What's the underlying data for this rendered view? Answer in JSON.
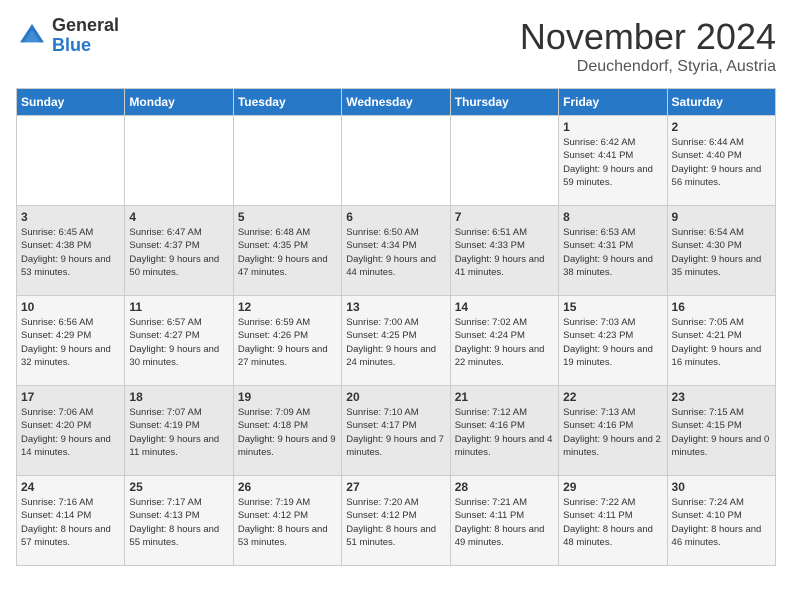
{
  "header": {
    "logo_general": "General",
    "logo_blue": "Blue",
    "month_title": "November 2024",
    "location": "Deuchendorf, Styria, Austria"
  },
  "weekdays": [
    "Sunday",
    "Monday",
    "Tuesday",
    "Wednesday",
    "Thursday",
    "Friday",
    "Saturday"
  ],
  "weeks": [
    [
      {
        "day": "",
        "info": ""
      },
      {
        "day": "",
        "info": ""
      },
      {
        "day": "",
        "info": ""
      },
      {
        "day": "",
        "info": ""
      },
      {
        "day": "",
        "info": ""
      },
      {
        "day": "1",
        "info": "Sunrise: 6:42 AM\nSunset: 4:41 PM\nDaylight: 9 hours and 59 minutes."
      },
      {
        "day": "2",
        "info": "Sunrise: 6:44 AM\nSunset: 4:40 PM\nDaylight: 9 hours and 56 minutes."
      }
    ],
    [
      {
        "day": "3",
        "info": "Sunrise: 6:45 AM\nSunset: 4:38 PM\nDaylight: 9 hours and 53 minutes."
      },
      {
        "day": "4",
        "info": "Sunrise: 6:47 AM\nSunset: 4:37 PM\nDaylight: 9 hours and 50 minutes."
      },
      {
        "day": "5",
        "info": "Sunrise: 6:48 AM\nSunset: 4:35 PM\nDaylight: 9 hours and 47 minutes."
      },
      {
        "day": "6",
        "info": "Sunrise: 6:50 AM\nSunset: 4:34 PM\nDaylight: 9 hours and 44 minutes."
      },
      {
        "day": "7",
        "info": "Sunrise: 6:51 AM\nSunset: 4:33 PM\nDaylight: 9 hours and 41 minutes."
      },
      {
        "day": "8",
        "info": "Sunrise: 6:53 AM\nSunset: 4:31 PM\nDaylight: 9 hours and 38 minutes."
      },
      {
        "day": "9",
        "info": "Sunrise: 6:54 AM\nSunset: 4:30 PM\nDaylight: 9 hours and 35 minutes."
      }
    ],
    [
      {
        "day": "10",
        "info": "Sunrise: 6:56 AM\nSunset: 4:29 PM\nDaylight: 9 hours and 32 minutes."
      },
      {
        "day": "11",
        "info": "Sunrise: 6:57 AM\nSunset: 4:27 PM\nDaylight: 9 hours and 30 minutes."
      },
      {
        "day": "12",
        "info": "Sunrise: 6:59 AM\nSunset: 4:26 PM\nDaylight: 9 hours and 27 minutes."
      },
      {
        "day": "13",
        "info": "Sunrise: 7:00 AM\nSunset: 4:25 PM\nDaylight: 9 hours and 24 minutes."
      },
      {
        "day": "14",
        "info": "Sunrise: 7:02 AM\nSunset: 4:24 PM\nDaylight: 9 hours and 22 minutes."
      },
      {
        "day": "15",
        "info": "Sunrise: 7:03 AM\nSunset: 4:23 PM\nDaylight: 9 hours and 19 minutes."
      },
      {
        "day": "16",
        "info": "Sunrise: 7:05 AM\nSunset: 4:21 PM\nDaylight: 9 hours and 16 minutes."
      }
    ],
    [
      {
        "day": "17",
        "info": "Sunrise: 7:06 AM\nSunset: 4:20 PM\nDaylight: 9 hours and 14 minutes."
      },
      {
        "day": "18",
        "info": "Sunrise: 7:07 AM\nSunset: 4:19 PM\nDaylight: 9 hours and 11 minutes."
      },
      {
        "day": "19",
        "info": "Sunrise: 7:09 AM\nSunset: 4:18 PM\nDaylight: 9 hours and 9 minutes."
      },
      {
        "day": "20",
        "info": "Sunrise: 7:10 AM\nSunset: 4:17 PM\nDaylight: 9 hours and 7 minutes."
      },
      {
        "day": "21",
        "info": "Sunrise: 7:12 AM\nSunset: 4:16 PM\nDaylight: 9 hours and 4 minutes."
      },
      {
        "day": "22",
        "info": "Sunrise: 7:13 AM\nSunset: 4:16 PM\nDaylight: 9 hours and 2 minutes."
      },
      {
        "day": "23",
        "info": "Sunrise: 7:15 AM\nSunset: 4:15 PM\nDaylight: 9 hours and 0 minutes."
      }
    ],
    [
      {
        "day": "24",
        "info": "Sunrise: 7:16 AM\nSunset: 4:14 PM\nDaylight: 8 hours and 57 minutes."
      },
      {
        "day": "25",
        "info": "Sunrise: 7:17 AM\nSunset: 4:13 PM\nDaylight: 8 hours and 55 minutes."
      },
      {
        "day": "26",
        "info": "Sunrise: 7:19 AM\nSunset: 4:12 PM\nDaylight: 8 hours and 53 minutes."
      },
      {
        "day": "27",
        "info": "Sunrise: 7:20 AM\nSunset: 4:12 PM\nDaylight: 8 hours and 51 minutes."
      },
      {
        "day": "28",
        "info": "Sunrise: 7:21 AM\nSunset: 4:11 PM\nDaylight: 8 hours and 49 minutes."
      },
      {
        "day": "29",
        "info": "Sunrise: 7:22 AM\nSunset: 4:11 PM\nDaylight: 8 hours and 48 minutes."
      },
      {
        "day": "30",
        "info": "Sunrise: 7:24 AM\nSunset: 4:10 PM\nDaylight: 8 hours and 46 minutes."
      }
    ]
  ]
}
